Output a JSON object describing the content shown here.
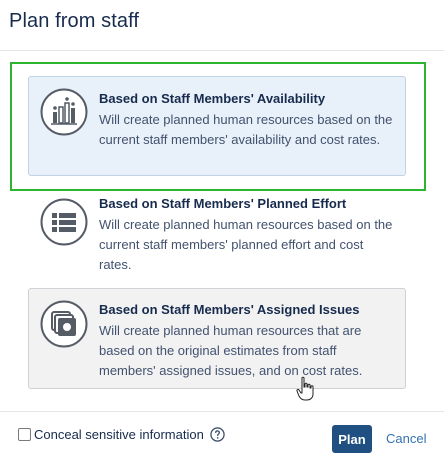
{
  "dialog": {
    "title": "Plan from staff"
  },
  "options": [
    {
      "title": "Based on Staff Members' Availability",
      "description": "Will create planned human resources based on the current staff members' availability and cost rates.",
      "icon": "availability-chart-icon",
      "state": "selected"
    },
    {
      "title": "Based on Staff Members' Planned Effort",
      "description": "Will create planned human resources based on the current staff members' planned effort and cost rates.",
      "icon": "list-icon",
      "state": "default"
    },
    {
      "title": "Based on Staff Members' Assigned Issues",
      "description": "Will create planned human resources that are based on the original estimates from staff members' assigned issues, and on cost rates.",
      "icon": "stacked-cards-icon",
      "state": "hovered"
    }
  ],
  "footer": {
    "conceal_label": "Conceal sensitive information",
    "conceal_checked": false,
    "plan_label": "Plan",
    "cancel_label": "Cancel"
  },
  "colors": {
    "highlight": "#2db52d",
    "primary": "#205081",
    "link": "#3572b0",
    "selected_bg": "#e8f0f9"
  }
}
